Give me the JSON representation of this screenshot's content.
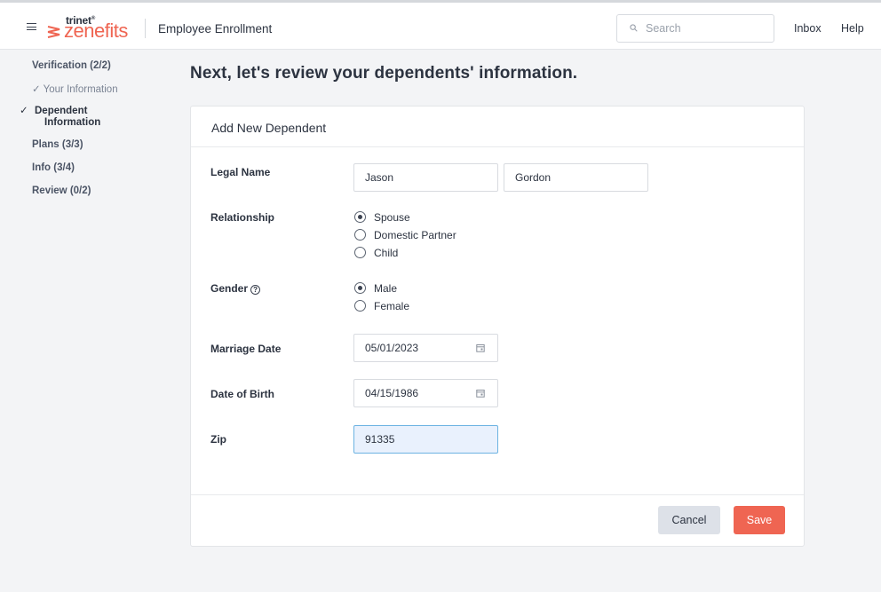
{
  "header": {
    "brand_small": "trinet",
    "brand_large": "zenefits",
    "app_title": "Employee Enrollment",
    "search_placeholder": "Search",
    "inbox": "Inbox",
    "help": "Help",
    "brand_color": "#ef6552"
  },
  "sidebar": {
    "verification": "Verification (2/2)",
    "your_information": "Your Information",
    "dependent_information": "Dependent Information",
    "plans": "Plans (3/3)",
    "info": "Info (3/4)",
    "review": "Review (0/2)",
    "check_glyph": "✓"
  },
  "main": {
    "heading": "Next, let's review your dependents' information.",
    "card_title": "Add New Dependent",
    "legal_name_label": "Legal Name",
    "first_name": "Jason",
    "last_name": "Gordon",
    "relationship_label": "Relationship",
    "relationship_options": [
      "Spouse",
      "Domestic Partner",
      "Child"
    ],
    "relationship_selected": "Spouse",
    "gender_label": "Gender",
    "gender_help_glyph": "?",
    "gender_options": [
      "Male",
      "Female"
    ],
    "gender_selected": "Male",
    "marriage_date_label": "Marriage Date",
    "marriage_date": "05/01/2023",
    "dob_label": "Date of Birth",
    "dob": "04/15/1986",
    "zip_label": "Zip",
    "zip": "91335",
    "cancel_label": "Cancel",
    "save_label": "Save"
  },
  "icons": [
    "hamburger-menu-icon",
    "zenefits-logo-icon",
    "search-icon",
    "check-icon",
    "help-circle-icon",
    "calendar-icon"
  ]
}
